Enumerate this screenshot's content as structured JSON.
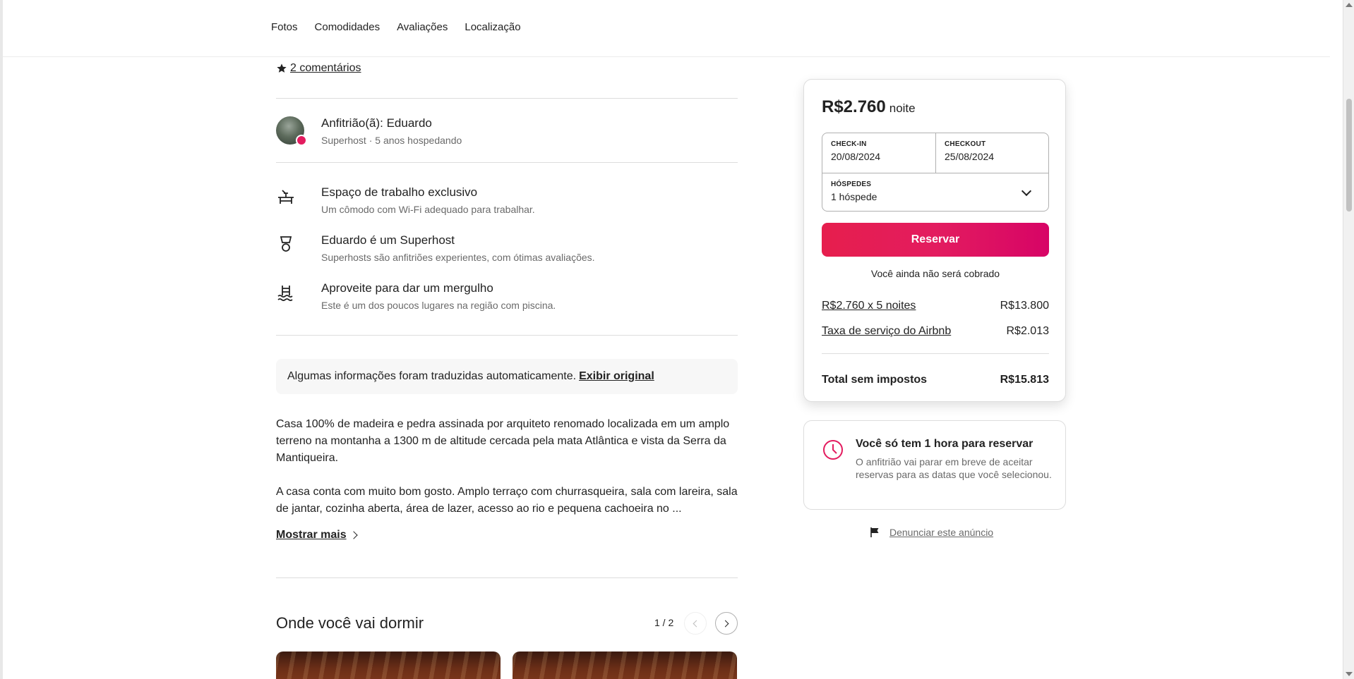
{
  "nav": {
    "items": [
      "Fotos",
      "Comodidades",
      "Avaliações",
      "Localização"
    ]
  },
  "listing": {
    "reviews_link": "2 comentários",
    "host": {
      "title": "Anfitrião(ã): Eduardo",
      "subtitle": "Superhost · 5 anos hospedando"
    },
    "highlights": [
      {
        "icon": "desk-icon",
        "title": "Espaço de trabalho exclusivo",
        "subtitle": "Um cômodo com Wi-Fi adequado para trabalhar."
      },
      {
        "icon": "superhost-medal-icon",
        "title": "Eduardo é um Superhost",
        "subtitle": "Superhosts são anfitriões experientes, com ótimas avaliações."
      },
      {
        "icon": "pool-icon",
        "title": "Aproveite para dar um mergulho",
        "subtitle": "Este é um dos poucos lugares na região com piscina."
      }
    ],
    "translation": {
      "text": "Algumas informações foram traduzidas automaticamente.",
      "link": "Exibir original"
    },
    "description": {
      "p1": "Casa 100% de madeira e pedra assinada por arquiteto renomado localizada em um amplo terreno na montanha a 1300 m de altitude cercada pela mata Atlântica e vista da Serra da Mantiqueira.",
      "p2": "A casa conta com muito bom gosto. Amplo terraço com churrasqueira, sala com lareira, sala de jantar, cozinha aberta, área de lazer, acesso ao rio e pequena cachoeira no ..."
    },
    "show_more": "Mostrar mais",
    "sleep": {
      "title": "Onde você vai dormir",
      "pager": "1 / 2"
    }
  },
  "booking": {
    "price": "R$2.760",
    "price_unit": "noite",
    "checkin_label": "CHECK-IN",
    "checkin_value": "20/08/2024",
    "checkout_label": "CHECKOUT",
    "checkout_value": "25/08/2024",
    "guests_label": "HÓSPEDES",
    "guests_value": "1 hóspede",
    "reserve_label": "Reservar",
    "no_charge": "Você ainda não será cobrado",
    "nights_label": "R$2.760 x 5 noites",
    "nights_value": "R$13.800",
    "fee_label": "Taxa de serviço do Airbnb",
    "fee_value": "R$2.013",
    "total_label": "Total sem impostos",
    "total_value": "R$15.813"
  },
  "notice": {
    "title": "Você só tem 1 hora para reservar",
    "text": "O anfitrião vai parar em breve de aceitar reservas para as datas que você selecionou."
  },
  "report_label": "Denunciar este anúncio",
  "colors": {
    "brand": "#e31c5f",
    "text": "#222222",
    "muted": "#6a6a6a",
    "border": "#dddddd"
  }
}
